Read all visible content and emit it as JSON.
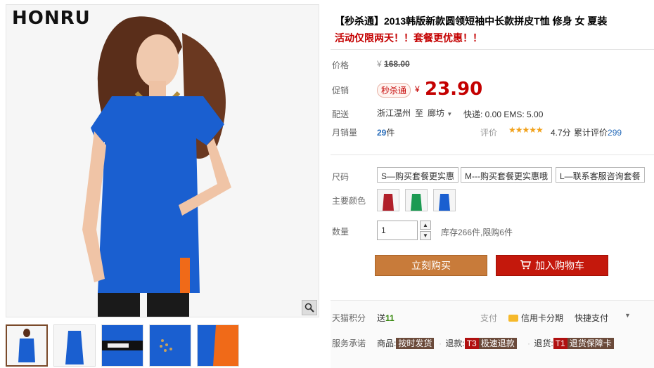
{
  "brand": {
    "logo_text": "HONRU"
  },
  "gallery": {
    "thumb_count": 5
  },
  "product": {
    "title": "【秒杀通】2013韩版新款圆领短袖中长款拼皮T恤 修身 女 夏装",
    "promo_text": "活动仅限两天！！套餐更优惠！！"
  },
  "price_row": {
    "label": "价格",
    "currency": "¥",
    "original": "168.00"
  },
  "promo_row": {
    "label": "促销",
    "tag": "秒杀通",
    "currency": "¥",
    "price": "23.90"
  },
  "delivery_row": {
    "label": "配送",
    "from": "浙江温州",
    "to_word": "至",
    "destination": "廊坊",
    "shipping": "快递: 0.00 EMS: 5.00"
  },
  "sales_row": {
    "label": "月销量",
    "count": "29",
    "unit": "件",
    "rating_label": "评价",
    "stars": "★★★★★",
    "score": "4.7分",
    "review_prefix": "累计评价",
    "review_count": "299"
  },
  "size_row": {
    "label": "尺码",
    "options": [
      "S—购买套餐更实惠",
      "M---购买套餐更实惠哦",
      "L—联系客服咨询套餐"
    ]
  },
  "color_row": {
    "label": "主要颜色",
    "swatches": [
      {
        "name": "red",
        "color": "#b0202a"
      },
      {
        "name": "green",
        "color": "#1c9a52"
      },
      {
        "name": "blue",
        "color": "#1a5fd0"
      }
    ]
  },
  "quantity_row": {
    "label": "数量",
    "value": "1",
    "stock": "库存266件,限购6件"
  },
  "buttons": {
    "buy_now": "立刻购买",
    "add_to_cart": "加入购物车"
  },
  "points_row": {
    "label": "天猫积分",
    "prefix": "送",
    "points": "11"
  },
  "payment_row": {
    "label": "支付",
    "credit": "信用卡分期",
    "quick": "快捷支付"
  },
  "service_row": {
    "label": "服务承诺",
    "items": [
      {
        "prefix": "商品:",
        "tag": "按时发货"
      },
      {
        "prefix": "退款:",
        "code": "T3",
        "tag": "极速退款"
      },
      {
        "prefix": "退货:",
        "code": "T1",
        "tag": "退货保障卡"
      }
    ]
  },
  "colors": {
    "accent_red": "#c40000",
    "buy_orange": "#c87b3a",
    "cart_red": "#c4180c",
    "link_blue": "#2a6ebb",
    "dress_blue": "#1a5fd0"
  }
}
